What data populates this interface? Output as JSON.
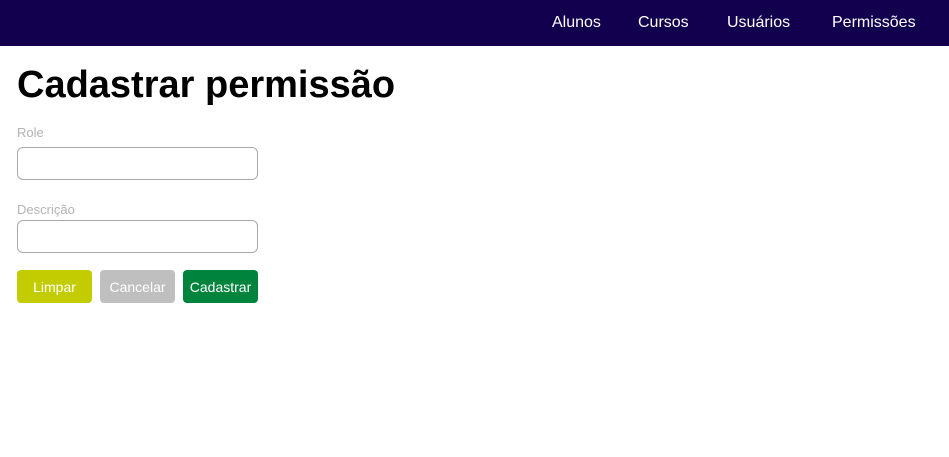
{
  "nav": {
    "items": [
      {
        "label": "Alunos"
      },
      {
        "label": "Cursos"
      },
      {
        "label": "Usuários"
      },
      {
        "label": "Permissões"
      }
    ]
  },
  "page": {
    "title": "Cadastrar permissão"
  },
  "form": {
    "role": {
      "label": "Role",
      "value": "",
      "placeholder": ""
    },
    "descricao": {
      "label": "Descrição",
      "value": "",
      "placeholder": ""
    },
    "buttons": {
      "limpar": "Limpar",
      "cancelar": "Cancelar",
      "cadastrar": "Cadastrar"
    }
  },
  "colors": {
    "navbar": "#12004f",
    "limpar": "#c2cc00",
    "cancelar": "#bfbfbf",
    "cadastrar": "#00843d"
  }
}
